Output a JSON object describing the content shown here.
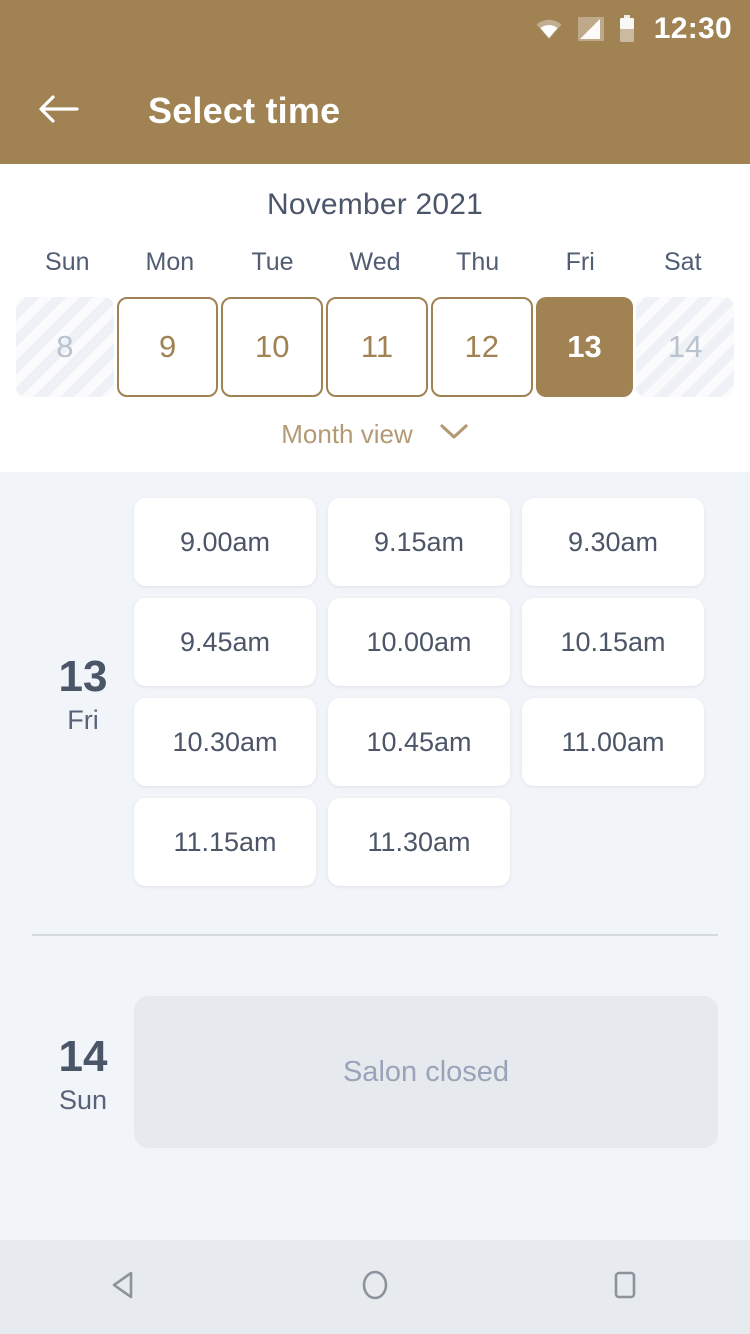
{
  "status_bar": {
    "time": "12:30",
    "icons": [
      "wifi-icon",
      "cellular-signal-icon",
      "battery-icon"
    ]
  },
  "app_bar": {
    "back_icon": "back-arrow-icon",
    "title": "Select time"
  },
  "calendar": {
    "month_title": "November 2021",
    "weekdays": [
      "Sun",
      "Mon",
      "Tue",
      "Wed",
      "Thu",
      "Fri",
      "Sat"
    ],
    "days": [
      {
        "number": "8",
        "state": "disabled"
      },
      {
        "number": "9",
        "state": "available"
      },
      {
        "number": "10",
        "state": "available"
      },
      {
        "number": "11",
        "state": "available"
      },
      {
        "number": "12",
        "state": "available"
      },
      {
        "number": "13",
        "state": "selected"
      },
      {
        "number": "14",
        "state": "disabled"
      }
    ],
    "month_view_label": "Month view",
    "month_view_icon": "chevron-down-icon"
  },
  "schedule": {
    "groups": [
      {
        "day_number": "13",
        "day_of_week": "Fri",
        "slots": [
          "9.00am",
          "9.15am",
          "9.30am",
          "9.45am",
          "10.00am",
          "10.15am",
          "10.30am",
          "10.45am",
          "11.00am",
          "11.15am",
          "11.30am"
        ],
        "closed_message": null
      },
      {
        "day_number": "14",
        "day_of_week": "Sun",
        "slots": [],
        "closed_message": "Salon closed"
      }
    ]
  },
  "nav_bar": {
    "buttons": [
      "back-triangle-icon",
      "home-circle-icon",
      "recents-square-icon"
    ]
  },
  "colors": {
    "brand": "#a08253",
    "brand_light": "#b39a74",
    "panel_bg": "#ffffff",
    "page_bg": "#f1f4f8",
    "slot_bg": "#ffffff",
    "closed_bg": "#e6eaef",
    "text_dark": "#4a5568",
    "text_muted": "#9aa4b8",
    "disabled_day": "#b9c2cf",
    "nav_bar_bg": "#e7eaee"
  }
}
